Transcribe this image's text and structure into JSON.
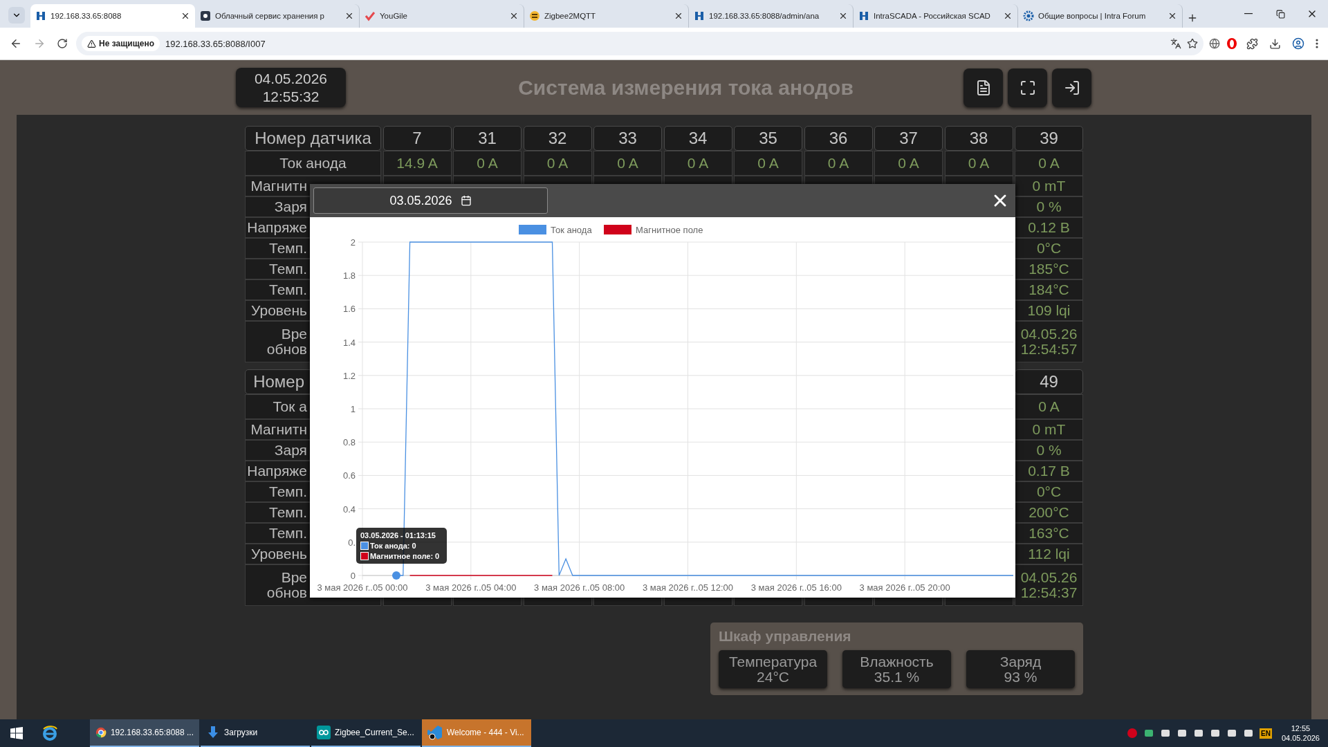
{
  "browser": {
    "tabs": [
      {
        "title": "192.168.33.65:8088",
        "kind": "intra",
        "selected": true
      },
      {
        "title": "Облачный сервис хранения р",
        "kind": "cloud",
        "selected": false
      },
      {
        "title": "YouGile",
        "kind": "yougile",
        "selected": false
      },
      {
        "title": "Zigbee2MQTT",
        "kind": "zigbee",
        "selected": false
      },
      {
        "title": "192.168.33.65:8088/admin/ana",
        "kind": "intra",
        "selected": false
      },
      {
        "title": "IntraSCADA - Российская SCAD",
        "kind": "intra",
        "selected": false
      },
      {
        "title": "Общие вопросы | Intra Forum",
        "kind": "forum",
        "selected": false
      }
    ],
    "address": {
      "security": "Не защищено",
      "url": "192.168.33.65:8088/I007"
    }
  },
  "header": {
    "date": "04.05.2026",
    "time": "12:55:32",
    "title": "Система измерения тока анодов"
  },
  "sensor_tables": [
    {
      "header_label": "Номер датчика",
      "numbers": [
        "7",
        "31",
        "32",
        "33",
        "34",
        "35",
        "36",
        "37",
        "38",
        "39"
      ],
      "rows": [
        {
          "label": "Ток анода",
          "values": [
            "14.9 A",
            "0 A",
            "0 A",
            "0 A",
            "0 A",
            "0 A",
            "0 A",
            "0 A",
            "0 A",
            "0 A"
          ]
        },
        {
          "label": "Магнитн",
          "values": [
            "0 mT"
          ]
        },
        {
          "label": "Заря",
          "values": [
            "0 %"
          ]
        },
        {
          "label": "Напряже",
          "values": [
            "0.12 В"
          ]
        },
        {
          "label": "Темп.",
          "values": [
            "0°C"
          ]
        },
        {
          "label": "Темп.",
          "values": [
            "185°C"
          ]
        },
        {
          "label": "Темп.",
          "values": [
            "184°C"
          ]
        },
        {
          "label": "Уровень",
          "values": [
            "109 lqi"
          ]
        },
        {
          "label": "Вре\nобнов",
          "values": [
            "04.05.26\n12:54:57"
          ]
        }
      ]
    },
    {
      "header_label": "Номер",
      "numbers": [
        "49"
      ],
      "rows": [
        {
          "label": "Ток а",
          "values": [
            "0 A"
          ]
        },
        {
          "label": "Магнитн",
          "values": [
            "0 mT"
          ]
        },
        {
          "label": "Заря",
          "values": [
            "0 %"
          ]
        },
        {
          "label": "Напряже",
          "values": [
            "0.17 В"
          ]
        },
        {
          "label": "Темп.",
          "values": [
            "0°C"
          ]
        },
        {
          "label": "Темп.",
          "values": [
            "200°C"
          ]
        },
        {
          "label": "Темп.",
          "values": [
            "163°C"
          ]
        },
        {
          "label": "Уровень",
          "values": [
            "112 lqi"
          ]
        },
        {
          "label": "Вре\nобнов",
          "values": [
            "04.05.26\n12:54:37"
          ]
        }
      ]
    }
  ],
  "modal": {
    "date": "03.05.2026",
    "chart_data": {
      "type": "line",
      "categories": [
        "3 мая 2026 г..05 00:00",
        null,
        null,
        null,
        null,
        null,
        null,
        null,
        null,
        null,
        null,
        null,
        null,
        null,
        null,
        null,
        "3 мая 2026 г..05 04:00",
        null,
        null,
        null,
        null,
        null,
        null,
        null,
        null,
        null,
        null,
        null,
        null,
        null,
        null,
        null,
        "3 мая 2026 г..05 08:00",
        null,
        null,
        null,
        null,
        null,
        null,
        null,
        null,
        null,
        null,
        null,
        null,
        null,
        null,
        null,
        "3 мая 2026 г..05 12:00",
        null,
        null,
        null,
        null,
        null,
        null,
        null,
        null,
        null,
        null,
        null,
        null,
        null,
        null,
        null,
        "3 мая 2026 г..05 16:00",
        null,
        null,
        null,
        null,
        null,
        null,
        null,
        null,
        null,
        null,
        null,
        null,
        null,
        null,
        null,
        "3 мая 2026 г..05 20:00",
        null,
        null,
        null,
        null,
        null,
        null,
        null,
        null,
        null,
        null,
        null,
        null,
        null,
        null,
        null,
        null
      ],
      "series": [
        {
          "name": "Ток анода",
          "color": "#4a90e2",
          "values": [
            null,
            null,
            null,
            null,
            null,
            0,
            0,
            2,
            2,
            2,
            2,
            2,
            2,
            2,
            2,
            2,
            2,
            2,
            2,
            2,
            2,
            2,
            2,
            2,
            2,
            2,
            2,
            2,
            2,
            0,
            0.1,
            0,
            0,
            0,
            0,
            0,
            0,
            0,
            0,
            0,
            0,
            0,
            0,
            0,
            0,
            0,
            0,
            0,
            0,
            0,
            0,
            0,
            0,
            0,
            0,
            0,
            0,
            0,
            0,
            0,
            0,
            0,
            0,
            0,
            0,
            0,
            0,
            0,
            0,
            0,
            0,
            0,
            0,
            0,
            0,
            0,
            0,
            0,
            0,
            0,
            0,
            0,
            0,
            0,
            0,
            0,
            0,
            0,
            0,
            0,
            0,
            0,
            0,
            0,
            0,
            0,
            0
          ]
        },
        {
          "name": "Магнитное поле",
          "color": "#d0021b",
          "values": [
            null,
            null,
            null,
            null,
            null,
            null,
            null,
            0,
            0,
            0,
            0,
            0,
            0,
            0,
            0,
            0,
            0,
            0,
            0,
            0,
            0,
            0,
            0,
            0,
            0,
            0,
            0,
            0,
            0,
            null,
            null,
            null,
            null,
            null,
            null,
            null,
            null,
            null,
            null,
            null,
            null,
            null,
            null,
            null,
            null,
            null,
            null,
            null,
            null,
            null,
            null,
            null,
            null,
            null,
            null,
            null,
            null,
            null,
            null,
            null,
            null,
            null,
            null,
            null,
            null,
            null,
            null,
            null,
            null,
            null,
            null,
            null,
            null,
            null,
            null,
            null,
            null,
            null,
            null,
            null,
            null,
            null,
            null,
            null,
            null,
            null,
            null,
            null,
            null,
            null,
            null,
            null,
            null,
            null,
            null,
            null,
            null
          ]
        }
      ],
      "grid": true,
      "legend": "top",
      "ylim": [
        0,
        2
      ],
      "yticks": [
        0,
        {
          "value": 0.2,
          "label": "0."
        },
        0.4,
        0.6,
        0.8,
        1,
        1.2,
        1.4,
        1.6,
        1.8,
        2
      ]
    },
    "tooltip": {
      "title": "03.05.2026 - 01:13:15",
      "items": [
        {
          "text": "Ток анода: 0",
          "color": "#4a90e2"
        },
        {
          "text": "Магнитное поле: 0",
          "color": "#d0021b"
        }
      ]
    }
  },
  "cabinet": {
    "title": "Шкаф управления",
    "cards": [
      {
        "label": "Температура",
        "value": "24°C"
      },
      {
        "label": "Влажность",
        "value": "35.1 %"
      },
      {
        "label": "Заряд",
        "value": "93 %"
      }
    ]
  },
  "taskbar": {
    "items": [
      {
        "label": "192.168.33.65:8088 ...",
        "kind": "chrome",
        "selected": true,
        "flashing": false
      },
      {
        "label": "Загрузки",
        "kind": "download",
        "selected": false,
        "flashing": false
      },
      {
        "label": "Zigbee_Current_Se...",
        "kind": "arduino",
        "selected": false,
        "flashing": false
      },
      {
        "label": "Welcome - 444 - Vi...",
        "kind": "vscode",
        "selected": false,
        "flashing": true
      }
    ],
    "language": "EN",
    "time": "12:55",
    "date": "04.05.2026"
  }
}
